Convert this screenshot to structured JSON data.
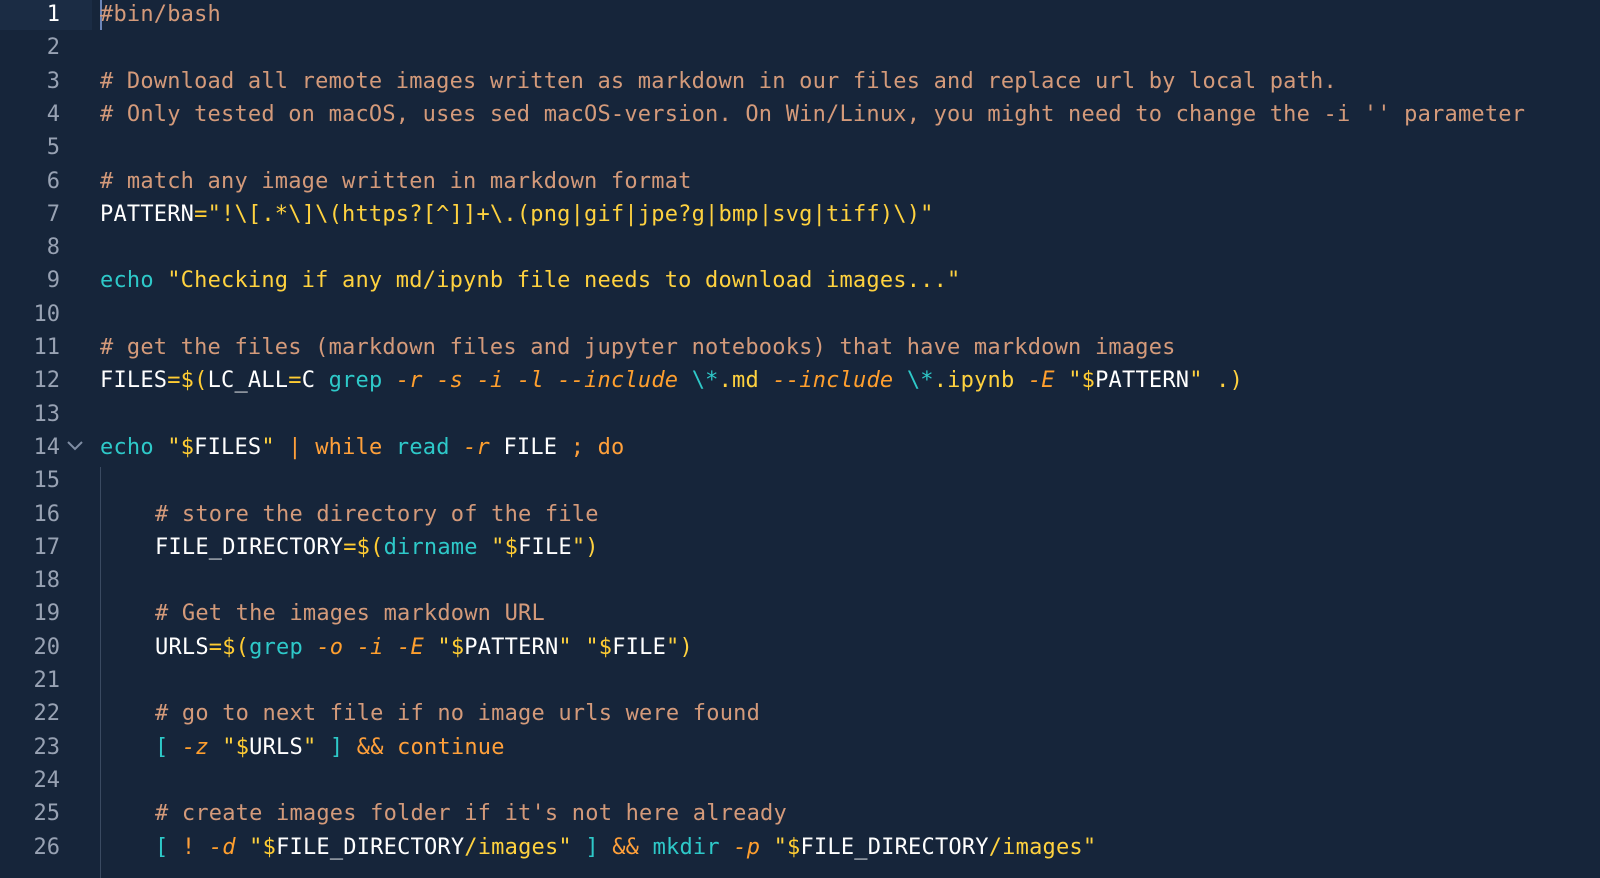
{
  "editor": {
    "active_line": 1,
    "line_numbers": [
      "1",
      "2",
      "3",
      "4",
      "5",
      "6",
      "7",
      "8",
      "9",
      "10",
      "11",
      "12",
      "13",
      "14",
      "15",
      "16",
      "17",
      "18",
      "19",
      "20",
      "21",
      "22",
      "23",
      "24",
      "25",
      "26"
    ],
    "fold_icon": "chevron-down-icon",
    "lines": [
      {
        "n": 1,
        "tokens": [
          [
            "comment",
            "#bin/bash"
          ]
        ]
      },
      {
        "n": 2,
        "tokens": []
      },
      {
        "n": 3,
        "tokens": [
          [
            "comment",
            "# Download all remote images written as markdown in our files and replace url by local path."
          ]
        ]
      },
      {
        "n": 4,
        "tokens": [
          [
            "comment",
            "# Only tested on macOS, uses sed macOS-version. On Win/Linux, you might need to change the -i '' parameter"
          ]
        ]
      },
      {
        "n": 5,
        "tokens": []
      },
      {
        "n": 6,
        "tokens": [
          [
            "comment",
            "# match any image written in markdown format"
          ]
        ]
      },
      {
        "n": 7,
        "tokens": [
          [
            "var",
            "PATTERN"
          ],
          [
            "op",
            "="
          ],
          [
            "str",
            "\"!\\[.*\\]\\(https?[^]]+\\.(png|gif|jpe?g|bmp|svg|tiff)\\)\""
          ]
        ]
      },
      {
        "n": 8,
        "tokens": []
      },
      {
        "n": 9,
        "tokens": [
          [
            "cmd",
            "echo"
          ],
          [
            "plain",
            " "
          ],
          [
            "str",
            "\"Checking if any md/ipynb file needs to download images...\""
          ]
        ]
      },
      {
        "n": 10,
        "tokens": []
      },
      {
        "n": 11,
        "tokens": [
          [
            "comment",
            "# get the files (markdown files and jupyter notebooks) that have markdown images"
          ]
        ]
      },
      {
        "n": 12,
        "tokens": [
          [
            "var",
            "FILES"
          ],
          [
            "op",
            "=$("
          ],
          [
            "var",
            "LC_ALL"
          ],
          [
            "op",
            "="
          ],
          [
            "var",
            "C"
          ],
          [
            "plain",
            " "
          ],
          [
            "cmd",
            "grep"
          ],
          [
            "plain",
            " "
          ],
          [
            "flag",
            "-r"
          ],
          [
            "plain",
            " "
          ],
          [
            "flag",
            "-s"
          ],
          [
            "plain",
            " "
          ],
          [
            "flag",
            "-i"
          ],
          [
            "plain",
            " "
          ],
          [
            "flag",
            "-l"
          ],
          [
            "plain",
            " "
          ],
          [
            "flag",
            "--include"
          ],
          [
            "plain",
            " "
          ],
          [
            "esc",
            "\\*"
          ],
          [
            "str",
            ".md"
          ],
          [
            "plain",
            " "
          ],
          [
            "flag",
            "--include"
          ],
          [
            "plain",
            " "
          ],
          [
            "esc",
            "\\*"
          ],
          [
            "str",
            ".ipynb"
          ],
          [
            "plain",
            " "
          ],
          [
            "flag",
            "-E"
          ],
          [
            "plain",
            " "
          ],
          [
            "str",
            "\""
          ],
          [
            "op",
            "$"
          ],
          [
            "var",
            "PATTERN"
          ],
          [
            "str",
            "\""
          ],
          [
            "plain",
            " "
          ],
          [
            "str",
            ".)"
          ]
        ]
      },
      {
        "n": 13,
        "tokens": []
      },
      {
        "n": 14,
        "tokens": [
          [
            "cmd",
            "echo"
          ],
          [
            "plain",
            " "
          ],
          [
            "str",
            "\""
          ],
          [
            "op",
            "$"
          ],
          [
            "var",
            "FILES"
          ],
          [
            "str",
            "\""
          ],
          [
            "plain",
            " "
          ],
          [
            "kw",
            "|"
          ],
          [
            "plain",
            " "
          ],
          [
            "kw",
            "while"
          ],
          [
            "plain",
            " "
          ],
          [
            "cmd",
            "read"
          ],
          [
            "plain",
            " "
          ],
          [
            "flag",
            "-r"
          ],
          [
            "plain",
            " "
          ],
          [
            "var",
            "FILE"
          ],
          [
            "plain",
            " "
          ],
          [
            "kw",
            ";"
          ],
          [
            "plain",
            " "
          ],
          [
            "kw",
            "do"
          ]
        ]
      },
      {
        "n": 15,
        "tokens": []
      },
      {
        "n": 16,
        "indent": true,
        "tokens": [
          [
            "comment",
            "# store the directory of the file"
          ]
        ]
      },
      {
        "n": 17,
        "indent": true,
        "tokens": [
          [
            "var",
            "FILE_DIRECTORY"
          ],
          [
            "op",
            "=$("
          ],
          [
            "cmd",
            "dirname"
          ],
          [
            "plain",
            " "
          ],
          [
            "str",
            "\""
          ],
          [
            "op",
            "$"
          ],
          [
            "var",
            "FILE"
          ],
          [
            "str",
            "\")"
          ]
        ]
      },
      {
        "n": 18,
        "tokens": []
      },
      {
        "n": 19,
        "indent": true,
        "tokens": [
          [
            "comment",
            "# Get the images markdown URL"
          ]
        ]
      },
      {
        "n": 20,
        "indent": true,
        "tokens": [
          [
            "var",
            "URLS"
          ],
          [
            "op",
            "=$("
          ],
          [
            "cmd",
            "grep"
          ],
          [
            "plain",
            " "
          ],
          [
            "flag",
            "-o"
          ],
          [
            "plain",
            " "
          ],
          [
            "flag",
            "-i"
          ],
          [
            "plain",
            " "
          ],
          [
            "flag",
            "-E"
          ],
          [
            "plain",
            " "
          ],
          [
            "str",
            "\""
          ],
          [
            "op",
            "$"
          ],
          [
            "var",
            "PATTERN"
          ],
          [
            "str",
            "\""
          ],
          [
            "plain",
            " "
          ],
          [
            "str",
            "\""
          ],
          [
            "op",
            "$"
          ],
          [
            "var",
            "FILE"
          ],
          [
            "str",
            "\")"
          ]
        ]
      },
      {
        "n": 21,
        "tokens": []
      },
      {
        "n": 22,
        "indent": true,
        "tokens": [
          [
            "comment",
            "# go to next file if no image urls were found"
          ]
        ]
      },
      {
        "n": 23,
        "indent": true,
        "tokens": [
          [
            "cmd",
            "["
          ],
          [
            "plain",
            " "
          ],
          [
            "flag",
            "-z"
          ],
          [
            "plain",
            " "
          ],
          [
            "str",
            "\""
          ],
          [
            "op",
            "$"
          ],
          [
            "var",
            "URLS"
          ],
          [
            "str",
            "\""
          ],
          [
            "plain",
            " "
          ],
          [
            "cmd",
            "]"
          ],
          [
            "plain",
            " "
          ],
          [
            "kw",
            "&&"
          ],
          [
            "plain",
            " "
          ],
          [
            "kw",
            "continue"
          ]
        ]
      },
      {
        "n": 24,
        "tokens": []
      },
      {
        "n": 25,
        "indent": true,
        "tokens": [
          [
            "comment",
            "# create images folder if it's not here already"
          ]
        ]
      },
      {
        "n": 26,
        "indent": true,
        "tokens": [
          [
            "cmd",
            "["
          ],
          [
            "plain",
            " "
          ],
          [
            "kw",
            "!"
          ],
          [
            "plain",
            " "
          ],
          [
            "flag",
            "-d"
          ],
          [
            "plain",
            " "
          ],
          [
            "str",
            "\""
          ],
          [
            "op",
            "$"
          ],
          [
            "var",
            "FILE_DIRECTORY"
          ],
          [
            "str",
            "/images\""
          ],
          [
            "plain",
            " "
          ],
          [
            "cmd",
            "]"
          ],
          [
            "plain",
            " "
          ],
          [
            "kw",
            "&&"
          ],
          [
            "plain",
            " "
          ],
          [
            "cmd",
            "mkdir"
          ],
          [
            "plain",
            " "
          ],
          [
            "flag",
            "-p"
          ],
          [
            "plain",
            " "
          ],
          [
            "str",
            "\""
          ],
          [
            "op",
            "$"
          ],
          [
            "var",
            "FILE_DIRECTORY"
          ],
          [
            "str",
            "/images\""
          ]
        ]
      }
    ]
  },
  "colors": {
    "background": "#16253a",
    "comment": "#d49a7a",
    "string": "#ffd23f",
    "command": "#2ec9c9",
    "flag": "#ff9f2e",
    "keyword": "#ffa03a",
    "variable": "#ffffff"
  }
}
